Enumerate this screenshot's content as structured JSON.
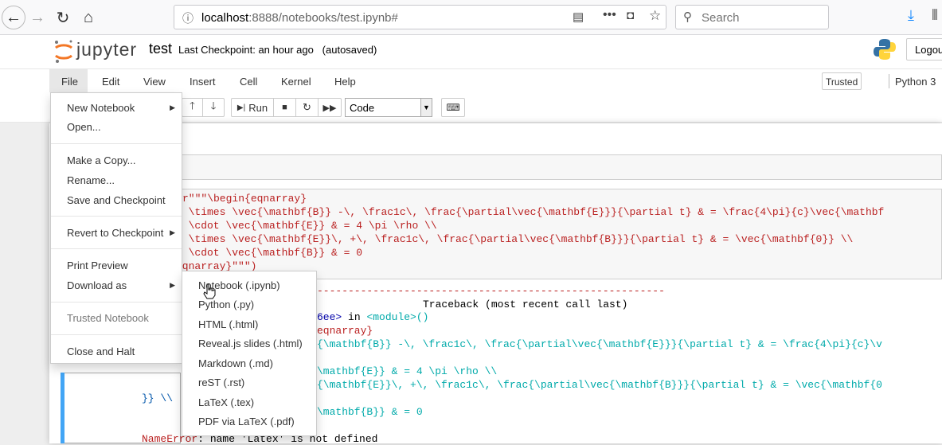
{
  "browser": {
    "url_host": "localhost",
    "url_rest": ":8888/notebooks/test.ipynb#",
    "search_placeholder": "Search"
  },
  "header": {
    "logo_text": "jupyter",
    "notebook_name": "test",
    "checkpoint": "Last Checkpoint: an hour ago   (autosaved)",
    "logout_label": "Logout"
  },
  "menubar": {
    "items": [
      "File",
      "Edit",
      "View",
      "Insert",
      "Cell",
      "Kernel",
      "Help"
    ],
    "trusted": "Trusted",
    "kernel": "Python 3"
  },
  "toolbar": {
    "run_label": "Run",
    "cell_type": "Code"
  },
  "file_menu": {
    "items": [
      "New Notebook",
      "Open...",
      "Make a Copy...",
      "Rename...",
      "Save and Checkpoint",
      "Revert to Checkpoint",
      "Print Preview",
      "Download as",
      "Trusted Notebook",
      "Close and Halt"
    ]
  },
  "download_menu": {
    "items": [
      "Notebook (.ipynb)",
      "Python (.py)",
      "HTML (.html)",
      "Reveal.js slides (.html)",
      "Markdown (.md)",
      "reST (.rst)",
      "LaTeX (.tex)",
      "PDF via LaTeX (.pdf)"
    ]
  },
  "code": {
    "lines": [
      "r\"\"\"\\begin{eqnarray}",
      "a \\times \\vec{\\mathbf{B}} -\\, \\frac1c\\, \\frac{\\partial\\vec{\\mathbf{E}}}{\\partial t} & = \\frac{4\\pi}{c}\\vec{\\mathbf",
      "a \\cdot \\vec{\\mathbf{E}} & = 4 \\pi \\rho \\\\",
      "a \\times \\vec{\\mathbf{E}}\\, +\\, \\frac1c\\, \\frac{\\partial\\vec{\\mathbf{B}}}{\\partial t} & = \\vec{\\mathbf{0}} \\\\",
      "a \\cdot \\vec{\\mathbf{B}} & = 0",
      "eqnarray}\"\"\")"
    ]
  },
  "output": {
    "dash_line": "--------------------------------------------------------",
    "traceback_header": "Traceback (most recent call last)",
    "module_ref_a": "6ee>",
    "module_ref_b": " in ",
    "module_ref_c": "<module>()",
    "eq_line": "eqnarray}",
    "line1": "{\\mathbf{B}} -\\, \\frac1c\\, \\frac{\\partial\\vec{\\mathbf{E}}}{\\partial t} & = \\frac{4\\pi}{c}\\v",
    "line2": "\\mathbf{E}} & = 4 \\pi \\rho \\\\",
    "line3": "{\\mathbf{E}}\\, +\\, \\frac1c\\, \\frac{\\partial\\vec{\\mathbf{B}}}{\\partial t} & = \\vec{\\mathbf{0",
    "line4": "\\mathbf{B}} & = 0",
    "cont_line": "}} \\\\",
    "error_name": "NameError",
    "error_msg": ": name 'Latex' is not defined"
  }
}
